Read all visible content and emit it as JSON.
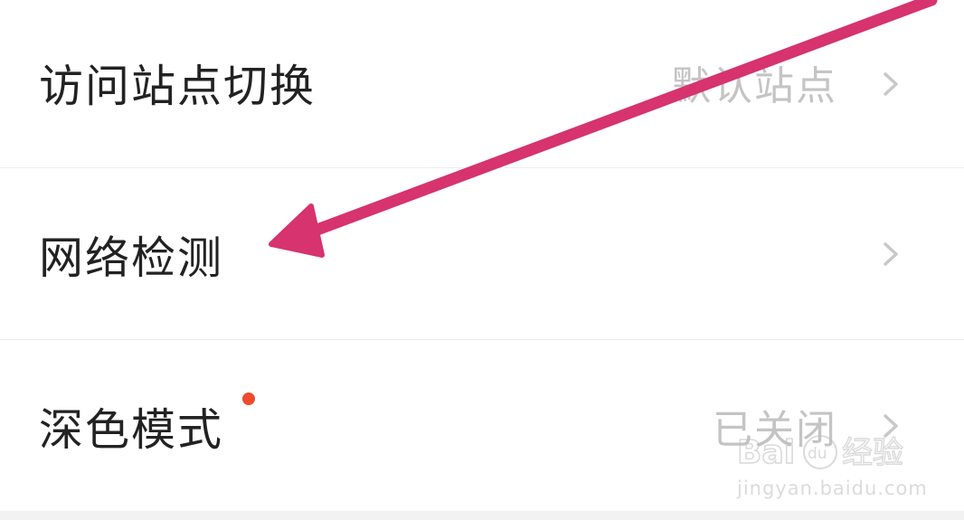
{
  "settings": {
    "rows": [
      {
        "label": "访问站点切换",
        "value": "默认站点",
        "has_new_dot": false
      },
      {
        "label": "网络检测",
        "value": "",
        "has_new_dot": false
      },
      {
        "label": "深色模式",
        "value": "已关闭",
        "has_new_dot": true
      }
    ]
  },
  "icons": {
    "chevron": "chevron-right-icon"
  },
  "colors": {
    "background": "#ffffff",
    "label": "#222222",
    "value": "#c4c4c4",
    "chevron": "#c8c8c8",
    "divider": "#ececec",
    "new_dot": "#f04a2e",
    "arrow": "#d6336f"
  },
  "watermark": {
    "brand": "Bai经验",
    "url": "jingyan.baidu.com"
  }
}
